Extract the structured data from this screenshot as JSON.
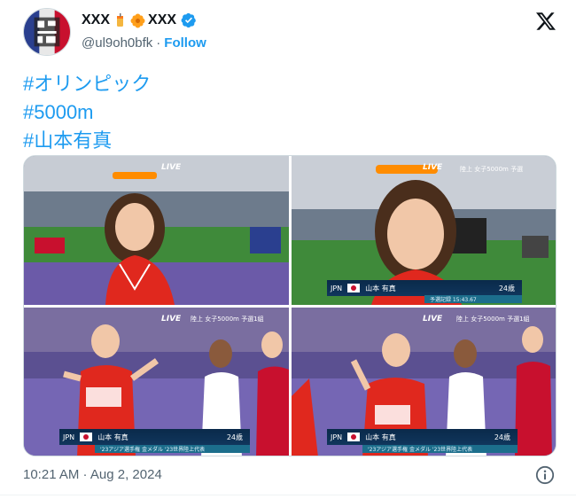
{
  "author": {
    "display_name_prefix": "XXX",
    "display_name_suffix": "XXX",
    "handle": "@ul9oh0bfk",
    "separator": "·",
    "follow_label": "Follow",
    "emoji_1": "drink-icon",
    "emoji_2": "flower-icon",
    "verified": true
  },
  "tweet": {
    "hashtags": [
      "#オリンピック",
      "#5000m",
      "#山本有真"
    ]
  },
  "photos": [
    {
      "id": "photo-1",
      "live": "LIVE",
      "topline": "",
      "bib": "",
      "sub": ""
    },
    {
      "id": "photo-2",
      "live": "LIVE",
      "topline": "陸上 女子5000m 予選",
      "country": "JPN",
      "athlete": "山本 有真",
      "bib": "24歳",
      "sub": "予選記録 15:43.67"
    },
    {
      "id": "photo-3",
      "live": "LIVE",
      "topline": "陸上 女子5000m 予選1組",
      "country": "JPN",
      "athlete": "山本 有真",
      "bib": "24歳",
      "sub": "'23アジア選手権 金メダル '23世界陸上代表"
    },
    {
      "id": "photo-4",
      "live": "LIVE",
      "topline": "陸上 女子5000m 予選1組",
      "country": "JPN",
      "athlete": "山本 有真",
      "bib": "24歳",
      "sub": "'23アジア選手権 金メダル '23世界陸上代表"
    }
  ],
  "footer": {
    "timestamp": "10:21 AM · Aug 2, 2024"
  },
  "colors": {
    "link": "#1d9bf0",
    "muted": "#536471",
    "track": "#6b5aa8",
    "grass": "#3f8a3a",
    "japan_red": "#c8102e"
  }
}
